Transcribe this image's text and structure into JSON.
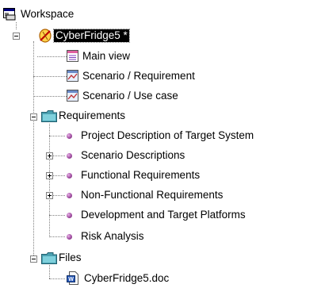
{
  "tree": {
    "root": {
      "label": "Workspace",
      "icon": "workspace-icon"
    },
    "project": {
      "label": "CyberFridge5 *",
      "icon": "project-icon"
    },
    "items": {
      "main_view": {
        "label": "Main view",
        "icon": "view-icon"
      },
      "scenario_requirement": {
        "label": "Scenario / Requirement",
        "icon": "diagram-icon"
      },
      "scenario_usecase": {
        "label": "Scenario / Use case",
        "icon": "diagram-icon"
      }
    },
    "requirements": {
      "label": "Requirements",
      "icon": "folder-icon",
      "children": [
        {
          "label": "Project Description of Target System",
          "expandable": false
        },
        {
          "label": "Scenario Descriptions",
          "expandable": true
        },
        {
          "label": "Functional Requirements",
          "expandable": true
        },
        {
          "label": "Non-Functional Requirements",
          "expandable": true
        },
        {
          "label": "Development and Target Platforms",
          "expandable": false
        },
        {
          "label": "Risk Analysis",
          "expandable": false
        }
      ]
    },
    "files": {
      "label": "Files",
      "icon": "folder-icon",
      "children": [
        {
          "label": "CyberFridge5.doc",
          "icon": "word-document-icon"
        }
      ]
    }
  }
}
